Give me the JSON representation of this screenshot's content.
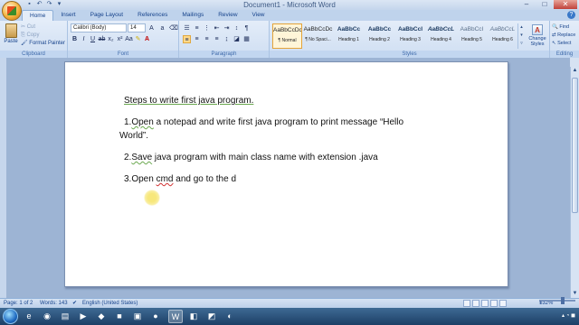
{
  "window": {
    "title": "Document1 - Microsoft Word",
    "minimize": "–",
    "maximize": "□",
    "close": "✕"
  },
  "tabs": [
    "Home",
    "Insert",
    "Page Layout",
    "References",
    "Mailings",
    "Review",
    "View"
  ],
  "ribbon": {
    "clipboard": {
      "label": "Clipboard",
      "paste": "Paste",
      "cut": "Cut",
      "copy": "Copy",
      "format_painter": "Format Painter"
    },
    "font": {
      "label": "Font",
      "font_name": "Calibri (Body)",
      "font_size": "14"
    },
    "paragraph": {
      "label": "Paragraph"
    },
    "styles": {
      "label": "Styles",
      "items": [
        {
          "sample": "AaBbCcDc",
          "name": "¶ Normal"
        },
        {
          "sample": "AaBbCcDc",
          "name": "¶ No Spaci..."
        },
        {
          "sample": "AaBbCc",
          "name": "Heading 1"
        },
        {
          "sample": "AaBbCc",
          "name": "Heading 2"
        },
        {
          "sample": "AaBbCcI",
          "name": "Heading 3"
        },
        {
          "sample": "AaBbCcL",
          "name": "Heading 4"
        },
        {
          "sample": "AaBbCcI",
          "name": "Heading 5"
        },
        {
          "sample": "AaBbCcL",
          "name": "Heading 6"
        }
      ],
      "change_styles": "Change Styles"
    },
    "editing": {
      "label": "Editing",
      "find": "Find",
      "replace": "Replace",
      "select": "Select"
    }
  },
  "document": {
    "heading": "Steps to write first java program.",
    "line1_num": "1.",
    "line1_word": "Open",
    "line1_rest": " a notepad and write first java program to print message “Hello",
    "line1_cont": "World”.",
    "line2_num": "2.",
    "line2_word": "Save",
    "line2_rest": " java program with main class name with extension .java",
    "line3_start": "3.Open ",
    "line3_word": "cmd",
    "line3_rest": " and go to the d"
  },
  "status": {
    "page": "Page: 1 of 2",
    "words": "Words: 143",
    "language": "English (United States)",
    "zoom": "132%"
  }
}
